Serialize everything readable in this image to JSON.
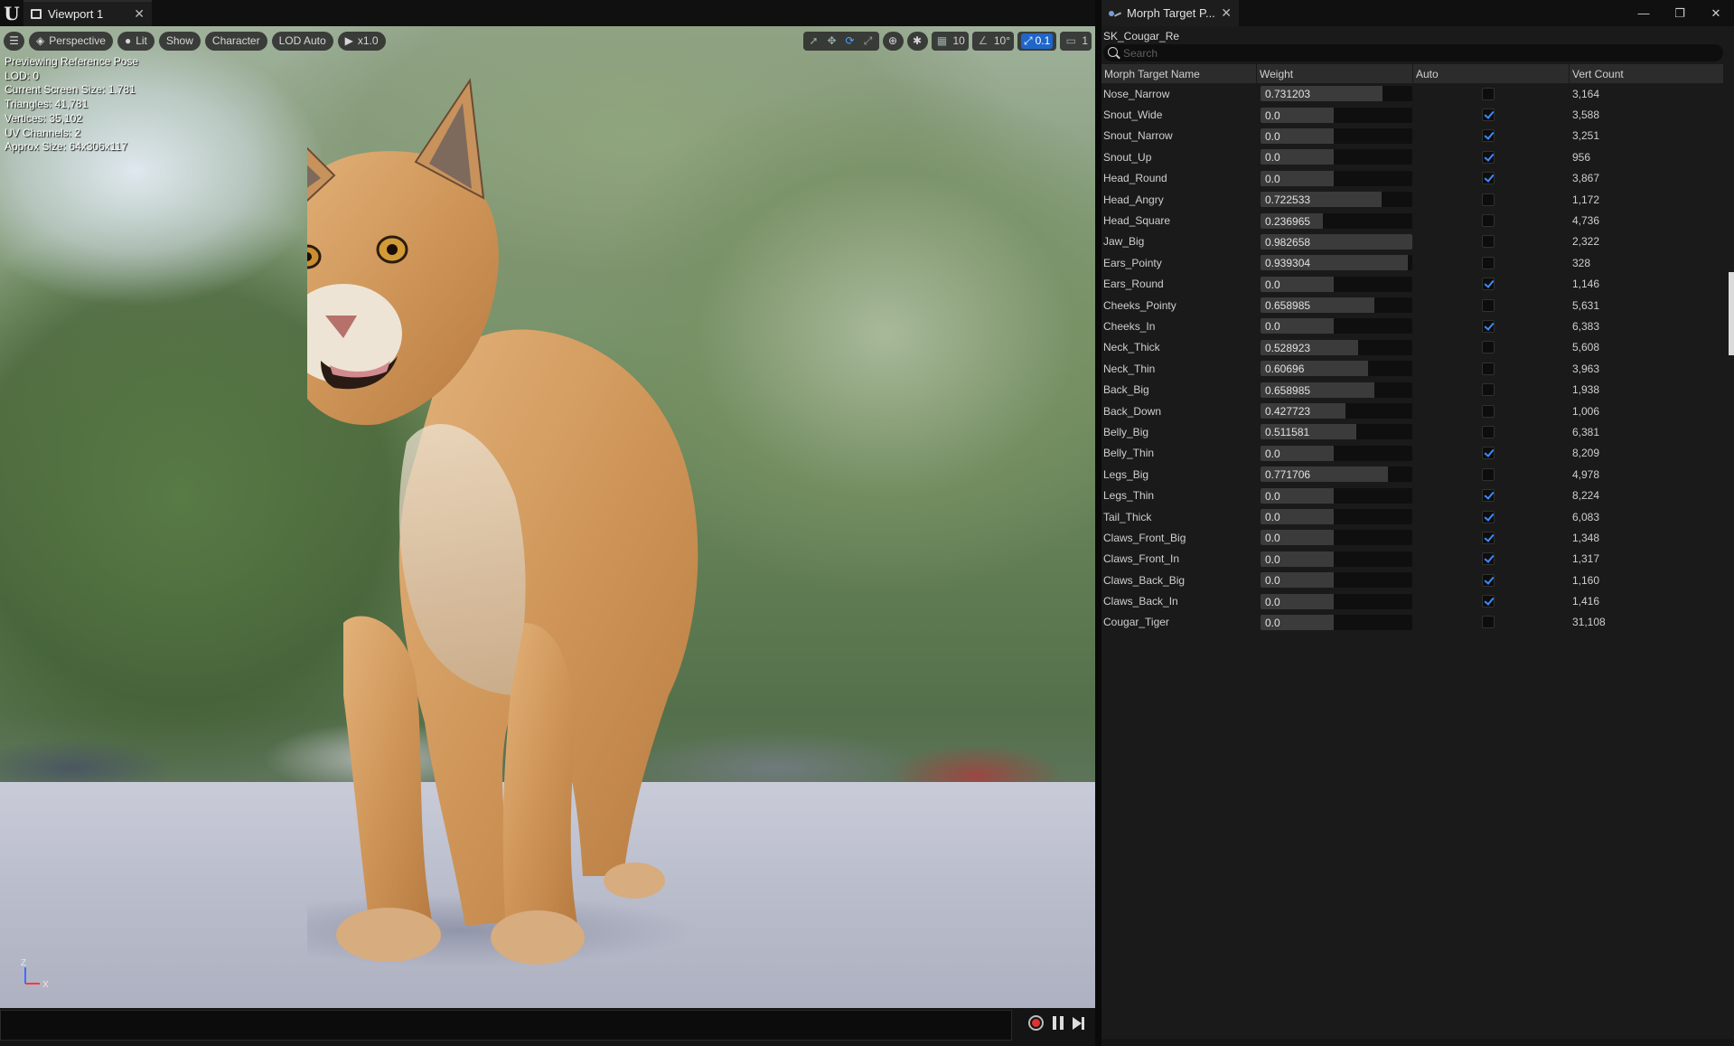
{
  "viewport_window": {
    "tab_title": "Viewport 1",
    "toolbar": {
      "view_mode": "Perspective",
      "lighting": "Lit",
      "show": "Show",
      "character": "Character",
      "lod": "LOD Auto",
      "play_speed": "x1.0",
      "grid_snap": "10",
      "rotation_snap": "10°",
      "scale_snap": "0.1",
      "camera_speed": "1"
    },
    "stats": [
      "Previewing Reference Pose",
      "LOD: 0",
      "Current Screen Size: 1.781",
      "Triangles: 41,781",
      "Vertices: 35,102",
      "UV Channels: 2",
      "Approx Size: 64x306x117"
    ],
    "axis": {
      "z": "Z",
      "x": "X"
    }
  },
  "morph_panel": {
    "tab_title": "Morph Target P...",
    "asset_name": "SK_Cougar_Re",
    "search_placeholder": "Search",
    "columns": [
      "Morph Target Name",
      "Weight",
      "Auto",
      "Vert Count"
    ],
    "rows": [
      {
        "name": "Nose_Narrow",
        "weight": "0.731203",
        "auto": false,
        "verts": "3,164"
      },
      {
        "name": "Snout_Wide",
        "weight": "0.0",
        "auto": true,
        "verts": "3,588"
      },
      {
        "name": "Snout_Narrow",
        "weight": "0.0",
        "auto": true,
        "verts": "3,251"
      },
      {
        "name": "Snout_Up",
        "weight": "0.0",
        "auto": true,
        "verts": "956"
      },
      {
        "name": "Head_Round",
        "weight": "0.0",
        "auto": true,
        "verts": "3,867"
      },
      {
        "name": "Head_Angry",
        "weight": "0.722533",
        "auto": false,
        "verts": "1,172"
      },
      {
        "name": "Head_Square",
        "weight": "0.236965",
        "auto": false,
        "verts": "4,736"
      },
      {
        "name": "Jaw_Big",
        "weight": "0.982658",
        "auto": false,
        "verts": "2,322"
      },
      {
        "name": "Ears_Pointy",
        "weight": "0.939304",
        "auto": false,
        "verts": "328"
      },
      {
        "name": "Ears_Round",
        "weight": "0.0",
        "auto": true,
        "verts": "1,146"
      },
      {
        "name": "Cheeks_Pointy",
        "weight": "0.658985",
        "auto": false,
        "verts": "5,631"
      },
      {
        "name": "Cheeks_In",
        "weight": "0.0",
        "auto": true,
        "verts": "6,383"
      },
      {
        "name": "Neck_Thick",
        "weight": "0.528923",
        "auto": false,
        "verts": "5,608"
      },
      {
        "name": "Neck_Thin",
        "weight": "0.60696",
        "auto": false,
        "verts": "3,963"
      },
      {
        "name": "Back_Big",
        "weight": "0.658985",
        "auto": false,
        "verts": "1,938"
      },
      {
        "name": "Back_Down",
        "weight": "0.427723",
        "auto": false,
        "verts": "1,006"
      },
      {
        "name": "Belly_Big",
        "weight": "0.511581",
        "auto": false,
        "verts": "6,381"
      },
      {
        "name": "Belly_Thin",
        "weight": "0.0",
        "auto": true,
        "verts": "8,209"
      },
      {
        "name": "Legs_Big",
        "weight": "0.771706",
        "auto": false,
        "verts": "4,978"
      },
      {
        "name": "Legs_Thin",
        "weight": "0.0",
        "auto": true,
        "verts": "8,224"
      },
      {
        "name": "Tail_Thick",
        "weight": "0.0",
        "auto": true,
        "verts": "6,083"
      },
      {
        "name": "Claws_Front_Big",
        "weight": "0.0",
        "auto": true,
        "verts": "1,348"
      },
      {
        "name": "Claws_Front_In",
        "weight": "0.0",
        "auto": true,
        "verts": "1,317"
      },
      {
        "name": "Claws_Back_Big",
        "weight": "0.0",
        "auto": true,
        "verts": "1,160"
      },
      {
        "name": "Claws_Back_In",
        "weight": "0.0",
        "auto": true,
        "verts": "1,416"
      },
      {
        "name": "Cougar_Tiger",
        "weight": "0.0",
        "auto": false,
        "verts": "31,108"
      }
    ]
  },
  "icons": {
    "ue_logo": "unreal-logo-icon",
    "hamburger": "hamburger-menu-icon",
    "perspective": "perspective-cube-icon",
    "lit": "lit-sphere-icon",
    "play": "play-icon",
    "select": "select-arrow-icon",
    "translate": "translate-icon",
    "rotate": "rotate-icon",
    "scale": "scale-icon",
    "world": "world-local-icon",
    "surface_snap": "surface-snap-icon",
    "grid": "grid-snap-icon",
    "angle": "angle-snap-icon",
    "scale_snap": "scale-snap-icon",
    "camera": "camera-speed-icon"
  },
  "colors": {
    "accent": "#3d8bff",
    "panel_bg": "#1a1a1a",
    "record": "#dd3333"
  }
}
